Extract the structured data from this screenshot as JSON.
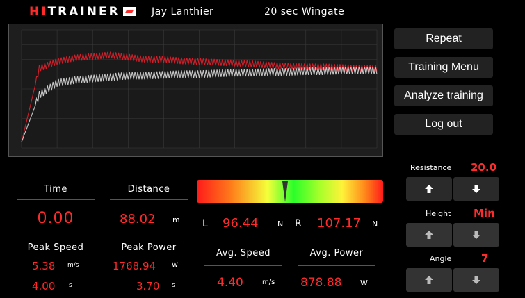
{
  "header": {
    "logo_hi": "HI",
    "logo_trainer": "TRAINER",
    "user": "Jay Lanthier",
    "program": "20 sec Wingate"
  },
  "chart_data": {
    "type": "line",
    "x": [
      0,
      1,
      2,
      3,
      4,
      5,
      6,
      7,
      8,
      9,
      10,
      11,
      12,
      13,
      14,
      15,
      16,
      17,
      18,
      19,
      20
    ],
    "series": [
      {
        "values": [
          0.4,
          5.4,
          5.85,
          6.1,
          6.2,
          6.3,
          6.15,
          6.0,
          6.0,
          5.9,
          5.85,
          5.8,
          5.75,
          5.7,
          5.6,
          5.55,
          5.5,
          5.5,
          5.45,
          5.4,
          5.4
        ]
      },
      {
        "values": [
          0.4,
          3.6,
          4.4,
          4.6,
          4.7,
          4.8,
          4.9,
          4.9,
          4.95,
          5.0,
          5.0,
          5.05,
          5.1,
          5.1,
          5.15,
          5.15,
          5.2,
          5.2,
          5.25,
          5.25,
          5.25
        ]
      }
    ],
    "ylim": [
      0,
      8
    ],
    "xlim": [
      0,
      20
    ],
    "grid": true,
    "colors": [
      "#d01f2a",
      "#c8c8c8"
    ]
  },
  "actions": {
    "repeat": "Repeat",
    "training_menu": "Training Menu",
    "analyze": "Analyze training",
    "logout": "Log out"
  },
  "controls": {
    "resistance": {
      "label": "Resistance",
      "value": "20.0"
    },
    "height": {
      "label": "Height",
      "value": "Min"
    },
    "angle": {
      "label": "Angle",
      "value": "7"
    }
  },
  "stats": {
    "time": {
      "label": "Time",
      "value": "0.00"
    },
    "distance": {
      "label": "Distance",
      "value": "88.02",
      "unit": "m"
    },
    "peak_speed": {
      "label": "Peak Speed",
      "value": "5.38",
      "unit": "m/s",
      "time": "4.00",
      "time_unit": "s"
    },
    "peak_power": {
      "label": "Peak Power",
      "value": "1768.94",
      "unit": "W",
      "time": "3.70",
      "time_unit": "s"
    },
    "left_force": {
      "side": "L",
      "value": "96.44",
      "unit": "N"
    },
    "right_force": {
      "side": "R",
      "value": "107.17",
      "unit": "N"
    },
    "avg_speed": {
      "label": "Avg. Speed",
      "value": "4.40",
      "unit": "m/s"
    },
    "avg_power": {
      "label": "Avg. Power",
      "value": "878.88",
      "unit": "W"
    }
  },
  "balance": {
    "left_fraction": 0.474
  }
}
